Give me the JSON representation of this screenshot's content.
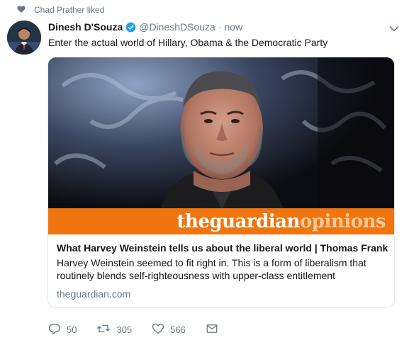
{
  "social_context": {
    "text": "Chad Prather liked",
    "icon": "heart-icon"
  },
  "tweet": {
    "author_name": "Dinesh D'Souza",
    "author_handle": "@DineshDSouza",
    "separator": "·",
    "timestamp": "now",
    "verified": true,
    "text": "Enter the actual world of Hillary, Obama & the Democratic Party"
  },
  "card": {
    "banner_brand": "theguardian",
    "banner_section": "opinions",
    "title": "What Harvey Weinstein tells us about the liberal world | Thomas Frank",
    "description": "Harvey Weinstein seemed to fit right in. This is a form of liberalism that routinely blends self-righteousness with upper-class entitlement",
    "domain": "theguardian.com"
  },
  "actions": {
    "reply_count": "50",
    "retweet_count": "305",
    "like_count": "566"
  },
  "colors": {
    "accent": "#1da1f2",
    "muted": "#657786",
    "guardian_orange": "#f0750f",
    "border": "#e1e8ed"
  }
}
